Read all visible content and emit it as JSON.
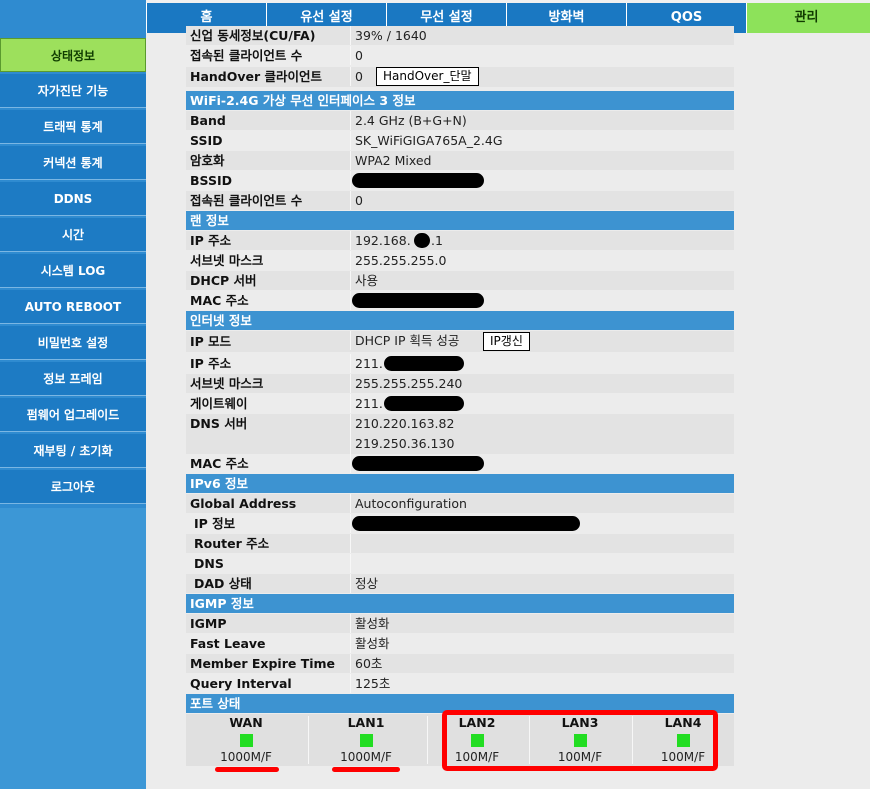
{
  "nav": {
    "tabs": [
      "홈",
      "유선 설정",
      "무선 설정",
      "방화벽",
      "QOS",
      "관리"
    ],
    "active_tab": "관리"
  },
  "sidebar": {
    "items": [
      "상태정보",
      "자가진단 기능",
      "트래픽 통계",
      "커넥션 통계",
      "DDNS",
      "시간",
      "시스템 LOG",
      "AUTO REBOOT",
      "비밀번호 설정",
      "정보 프레임",
      "펌웨어 업그레이드",
      "재부팅 / 초기화",
      "로그아웃"
    ],
    "active": "상태정보"
  },
  "wifi5": {
    "partial_label": "신업 동세정보(CU/FA)",
    "partial_value": "39% / 1640",
    "clients_label": "접속된 클라이언트 수",
    "clients_value": "0",
    "handover_label": "HandOver 클라이언트",
    "handover_value": "0",
    "handover_button": "HandOver_단말"
  },
  "wifi24": {
    "header": "WiFi-2.4G 가상 무선 인터페이스 3 정보",
    "band_label": "Band",
    "band_value": "2.4 GHz (B+G+N)",
    "ssid_label": "SSID",
    "ssid_value": "SK_WiFiGIGA765A_2.4G",
    "enc_label": "암호화",
    "enc_value": "WPA2 Mixed",
    "bssid_label": "BSSID",
    "clients_label": "접속된 클라이언트 수",
    "clients_value": "0"
  },
  "lan": {
    "header": "랜 정보",
    "ip_label": "IP 주소",
    "ip_value_a": "192.168.",
    "ip_value_b": ".1",
    "mask_label": "서브넷 마스크",
    "mask_value": "255.255.255.0",
    "dhcp_label": "DHCP 서버",
    "dhcp_value": "사용",
    "mac_label": "MAC 주소"
  },
  "internet": {
    "header": "인터넷 정보",
    "mode_label": "IP 모드",
    "mode_value": "DHCP IP 획득 성공",
    "renew_button": "IP갱신",
    "ip_label": "IP 주소",
    "ip_value": "211.",
    "mask_label": "서브넷 마스크",
    "mask_value": "255.255.255.240",
    "gw_label": "게이트웨이",
    "gw_value": "211.",
    "dns_label": "DNS 서버",
    "dns1": "210.220.163.82",
    "dns2": "219.250.36.130",
    "mac_label": "MAC 주소"
  },
  "ipv6": {
    "header": "IPv6 정보",
    "global_label": "Global Address",
    "global_value": "Autoconfiguration",
    "ip_label": "IP 정보",
    "router_label": "Router 주소",
    "dns_label": "DNS",
    "dad_label": "DAD 상태",
    "dad_value": "정상"
  },
  "igmp": {
    "header": "IGMP 정보",
    "igmp_label": "IGMP",
    "igmp_value": "활성화",
    "fast_label": "Fast Leave",
    "fast_value": "활성화",
    "expire_label": "Member Expire Time",
    "expire_value": "60초",
    "query_label": "Query Interval",
    "query_value": "125초"
  },
  "ports": {
    "header": "포트 상태",
    "list": [
      {
        "name": "WAN",
        "speed": "1000M/F"
      },
      {
        "name": "LAN1",
        "speed": "1000M/F"
      },
      {
        "name": "LAN2",
        "speed": "100M/F"
      },
      {
        "name": "LAN3",
        "speed": "100M/F"
      },
      {
        "name": "LAN4",
        "speed": "100M/F"
      }
    ],
    "led_color": "#22dd22"
  },
  "colors": {
    "nav_blue": "#1a78c2",
    "active_green": "#8de25a",
    "section_header": "#3d93d1",
    "annotation_red": "#ff0000"
  }
}
